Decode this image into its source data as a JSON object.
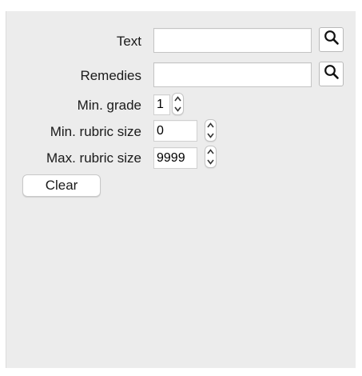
{
  "search_panel": {
    "text": {
      "label": "Text",
      "value": ""
    },
    "remedies": {
      "label": "Remedies",
      "value": ""
    },
    "min_grade": {
      "label": "Min. grade",
      "value": "1"
    },
    "min_rubric_size": {
      "label": "Min. rubric size",
      "value": "0"
    },
    "max_rubric_size": {
      "label": "Max. rubric size",
      "value": "9999"
    },
    "clear_label": "Clear",
    "search_icon": "magnifier-icon",
    "stepper_icons": [
      "chevron-up-icon",
      "chevron-down-icon"
    ]
  }
}
